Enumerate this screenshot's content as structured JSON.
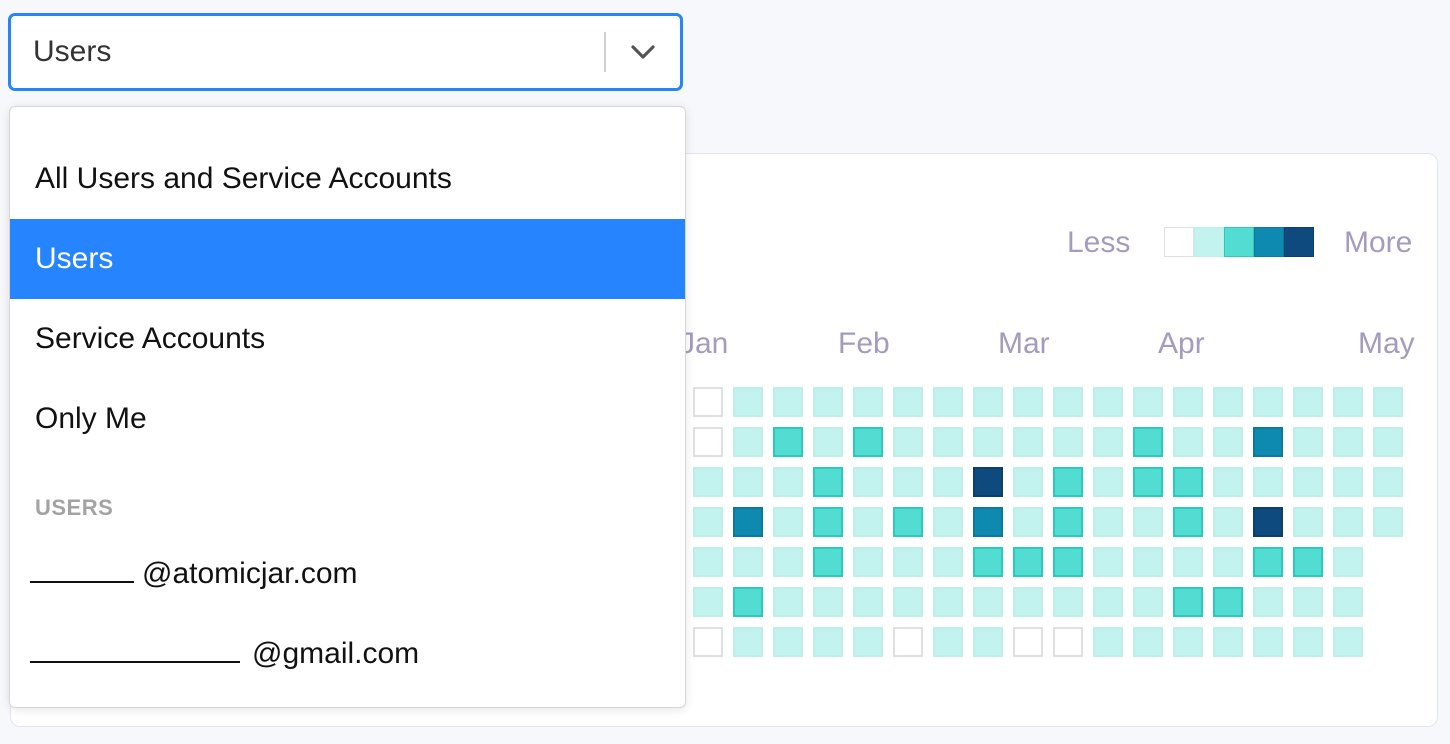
{
  "select": {
    "value": "Users"
  },
  "menu": {
    "options": [
      {
        "label": "All Users and Service Accounts",
        "selected": false
      },
      {
        "label": "Users",
        "selected": true
      },
      {
        "label": "Service Accounts",
        "selected": false
      },
      {
        "label": "Only Me",
        "selected": false
      }
    ],
    "group_heading": "USERS",
    "users": [
      {
        "domain": "@atomicjar.com"
      },
      {
        "domain": "@gmail.com"
      }
    ]
  },
  "legend": {
    "less": "Less",
    "more": "More",
    "colors": [
      "#ffffff",
      "#c3f3ef",
      "#52dcd2",
      "#0e89b0",
      "#0e4a7e"
    ]
  },
  "heatmap": {
    "months": [
      "Jan",
      "Feb",
      "Mar",
      "Apr",
      "May"
    ],
    "levels": [
      [
        0,
        1,
        1,
        1,
        1,
        1,
        1,
        1,
        1,
        1,
        1,
        1,
        1,
        1,
        1,
        1,
        1,
        1
      ],
      [
        0,
        1,
        2,
        1,
        2,
        1,
        1,
        1,
        1,
        1,
        1,
        2,
        1,
        1,
        3,
        1,
        1,
        1
      ],
      [
        1,
        1,
        1,
        2,
        1,
        1,
        1,
        4,
        1,
        2,
        1,
        2,
        2,
        1,
        1,
        1,
        1,
        1
      ],
      [
        1,
        3,
        1,
        2,
        1,
        2,
        1,
        3,
        1,
        2,
        1,
        1,
        2,
        1,
        4,
        1,
        1,
        1
      ],
      [
        1,
        1,
        1,
        2,
        1,
        1,
        1,
        2,
        2,
        2,
        1,
        1,
        1,
        1,
        2,
        2,
        1,
        null
      ],
      [
        1,
        2,
        1,
        1,
        1,
        1,
        1,
        1,
        1,
        1,
        1,
        1,
        2,
        2,
        1,
        1,
        1,
        null
      ],
      [
        0,
        1,
        1,
        1,
        1,
        0,
        1,
        1,
        0,
        0,
        1,
        1,
        1,
        1,
        1,
        1,
        1,
        null
      ]
    ]
  }
}
